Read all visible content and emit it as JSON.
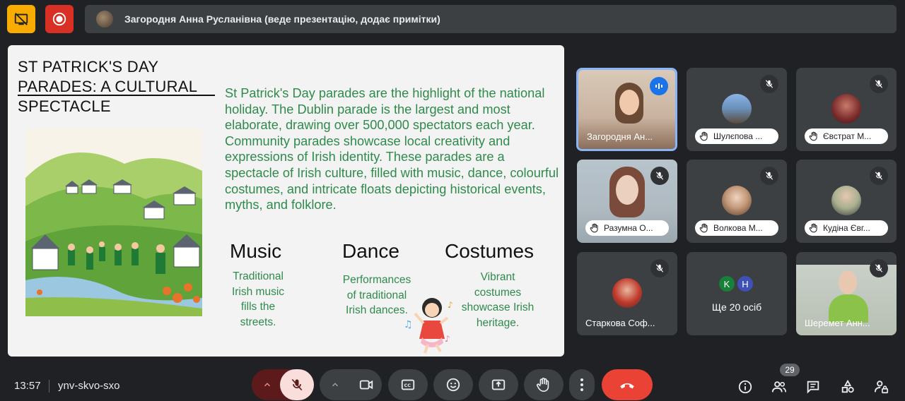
{
  "top_bar": {
    "presenter_text": "Загородня Анна Русланівна (веде презентацію, додає примітки)"
  },
  "slide": {
    "title": "ST PATRICK'S DAY PARADES: A CULTURAL SPECTACLE",
    "body": "St Patrick's Day parades are the highlight of the national holiday. The Dublin parade is the largest and most elaborate, drawing over 500,000 spectators each year. Community parades showcase local creativity and expressions of Irish identity. These parades are a spectacle of Irish culture, filled with music, dance, colourful costumes, and intricate floats depicting historical events, myths, and folklore.",
    "columns": [
      {
        "title": "Music",
        "text": "Traditional Irish music fills the streets."
      },
      {
        "title": "Dance",
        "text": "Performances of traditional Irish dances."
      },
      {
        "title": "Costumes",
        "text": "Vibrant costumes showcase Irish heritage."
      }
    ]
  },
  "participants": [
    {
      "name": "Загородня Ан...",
      "speaking": true
    },
    {
      "name": "Шулєпова ...",
      "hand": true
    },
    {
      "name": "Євстрат М...",
      "hand": true
    },
    {
      "name": "Разумна О...",
      "hand": true
    },
    {
      "name": "Волкова М...",
      "hand": true
    },
    {
      "name": "Кудіна Євг...",
      "hand": true
    },
    {
      "name": "Старкова Соф..."
    },
    {
      "name": "Ще 20 осіб",
      "initials": [
        "K",
        "H"
      ]
    },
    {
      "name": "Шеремет Анн..."
    }
  ],
  "bottom_bar": {
    "time": "13:57",
    "meeting_code": "ynv-skvo-sxo",
    "participants_count": "29"
  },
  "colors": {
    "background": "#202124",
    "tile": "#3c4043",
    "active_border": "#8ab4f8",
    "end_call": "#ea4335",
    "mic_muted": "#f9dedc",
    "slide_green": "#2f8a4c"
  }
}
